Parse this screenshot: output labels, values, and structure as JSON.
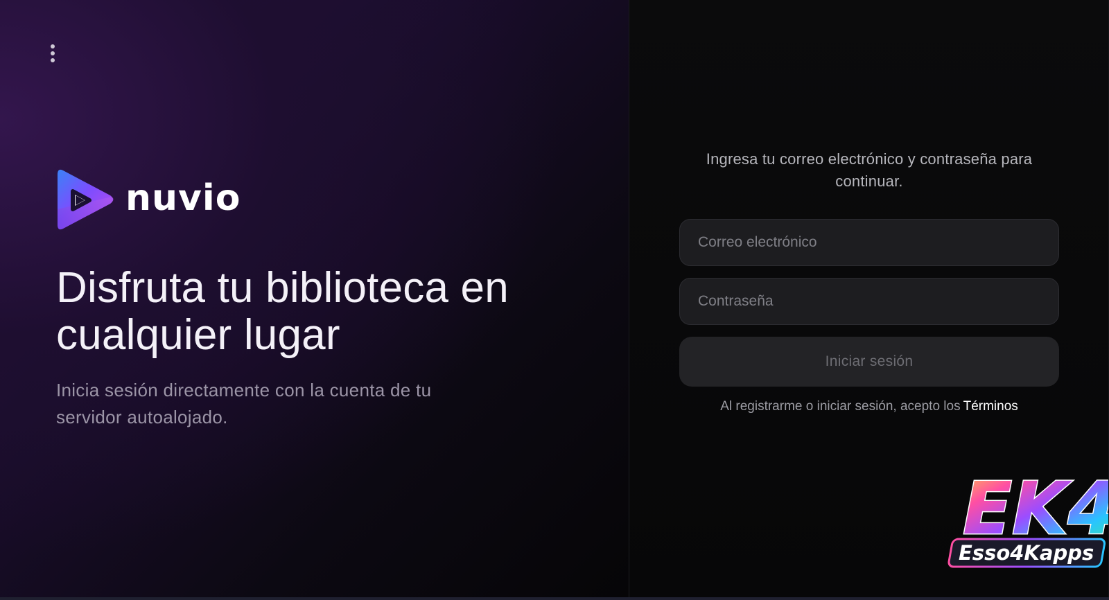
{
  "brand": {
    "name": "nuvio",
    "logo_icon": "play-triangle-logo-icon"
  },
  "menu": {
    "icon": "more-vertical-icon"
  },
  "hero": {
    "headline": "Disfruta tu biblioteca en cualquier lugar",
    "subline": "Inicia sesión directamente con la cuenta de tu servidor autoalojado."
  },
  "login": {
    "intro": "Ingresa tu correo electrónico y contraseña para continuar.",
    "email": {
      "value": "",
      "placeholder": "Correo electrónico"
    },
    "password": {
      "value": "",
      "placeholder": "Contraseña"
    },
    "submit_label": "Iniciar sesión",
    "terms_text": "Al registrarme o iniciar sesión, acepto los",
    "terms_link": "Términos"
  },
  "watermark": {
    "badge": "EK4",
    "name": "Esso4Kapps"
  },
  "colors": {
    "accent_purple": "#8b5cf6",
    "accent_blue": "#3b82f6",
    "panel_left": "#1a0d2c",
    "panel_right": "#0b0b0c",
    "input_bg": "#1d1d20"
  }
}
